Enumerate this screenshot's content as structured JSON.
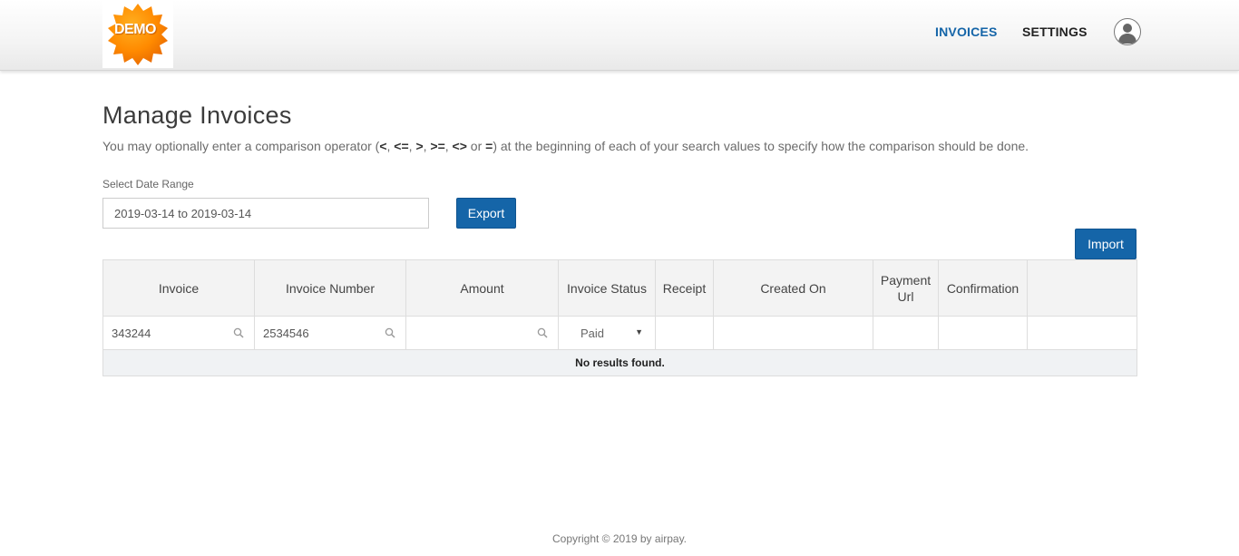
{
  "brand": {
    "logo_text": "DEMO",
    "colors": {
      "accent": "#1565a8",
      "logo_orange": "#ff8c00"
    }
  },
  "nav": {
    "invoices": "INVOICES",
    "settings": "SETTINGS",
    "avatar_icon": "user-avatar-icon"
  },
  "page": {
    "title": "Manage Invoices",
    "description": {
      "pre": "You may optionally enter a comparison operator (",
      "op1": "<",
      "sep1": ", ",
      "op2": "<=",
      "sep2": ", ",
      "op3": ">",
      "sep3": ", ",
      "op4": ">=",
      "sep4": ", ",
      "op5": "<>",
      "sep5": " or ",
      "op6": "=",
      "post": ") at the beginning of each of your search values to specify how the comparison should be done."
    }
  },
  "date_range": {
    "label": "Select Date Range",
    "value": "2019-03-14 to 2019-03-14"
  },
  "buttons": {
    "export": "Export",
    "import": "Import"
  },
  "table": {
    "headers": {
      "invoice": "Invoice",
      "invoice_number": "Invoice Number",
      "amount": "Amount",
      "invoice_status": "Invoice Status",
      "receipt": "Receipt",
      "created_on": "Created On",
      "payment_url_1": "Payment",
      "payment_url_2": "Url",
      "confirmation": "Confirmation",
      "actions": ""
    },
    "filters": {
      "invoice": "343244",
      "invoice_number": "2534546",
      "amount": "",
      "invoice_status": "Paid"
    },
    "empty_message": "No results found."
  },
  "footer": {
    "copyright": "Copyright © 2019 by airpay."
  }
}
